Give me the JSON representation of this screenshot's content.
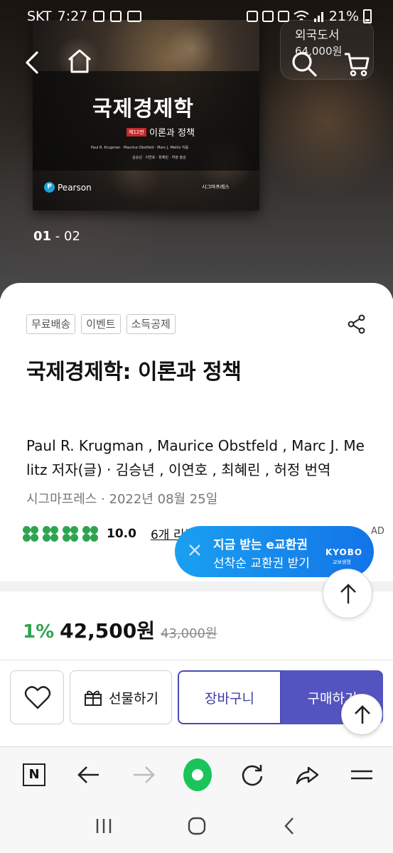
{
  "status_bar": {
    "carrier": "SKT",
    "time": "7:27",
    "battery": "21%"
  },
  "hero": {
    "book_cover": {
      "title": "국제경제학",
      "edition": "제12판",
      "subtitle": "이론과 정책",
      "authors_en": "Paul R. Krugman · Maurice Obstfeld · Marc J. Melitz 지음",
      "authors_ko": "김승년 · 이연호 · 최혜린 · 허정 옮김",
      "publisher_brand": "Pearson",
      "publisher_logo": "시그마프레스"
    },
    "slide_current": "01",
    "slide_total": "- 02",
    "header_overlay_line1": "외국도서",
    "header_overlay_line2": "64,000원"
  },
  "product": {
    "tags": [
      "무료배송",
      "이벤트",
      "소득공제"
    ],
    "title": "국제경제학: 이론과 정책",
    "authors_line": "Paul R. Krugman , Maurice Obstfeld , Marc J. Melitz 저자(글) · 김승년 , 이연호 , 최혜린 , 허정 번역",
    "pub_info": "시그마프레스 · 2022년 08월 25일",
    "rating_score": "10.0",
    "rating_clovers": 4,
    "reviews_label": "6개 리뷰"
  },
  "ad": {
    "label": "AD",
    "line1": "지금 받는 e교환권",
    "line2": "선착순 교환권 받기",
    "brand": "KYOBO",
    "brand_sub": "교보생명"
  },
  "price": {
    "discount": "1%",
    "sale_price": "42,500원",
    "original_price": "43,000원"
  },
  "actions": {
    "gift_label": "선물하기",
    "cart_label": "장바구니",
    "buy_label": "구매하기"
  },
  "browser_toolbar": {
    "n_label": "N"
  },
  "colors": {
    "accent_green": "#2ea44f",
    "buy_purple": "#5454c0",
    "ad_blue": "#1374e8"
  }
}
